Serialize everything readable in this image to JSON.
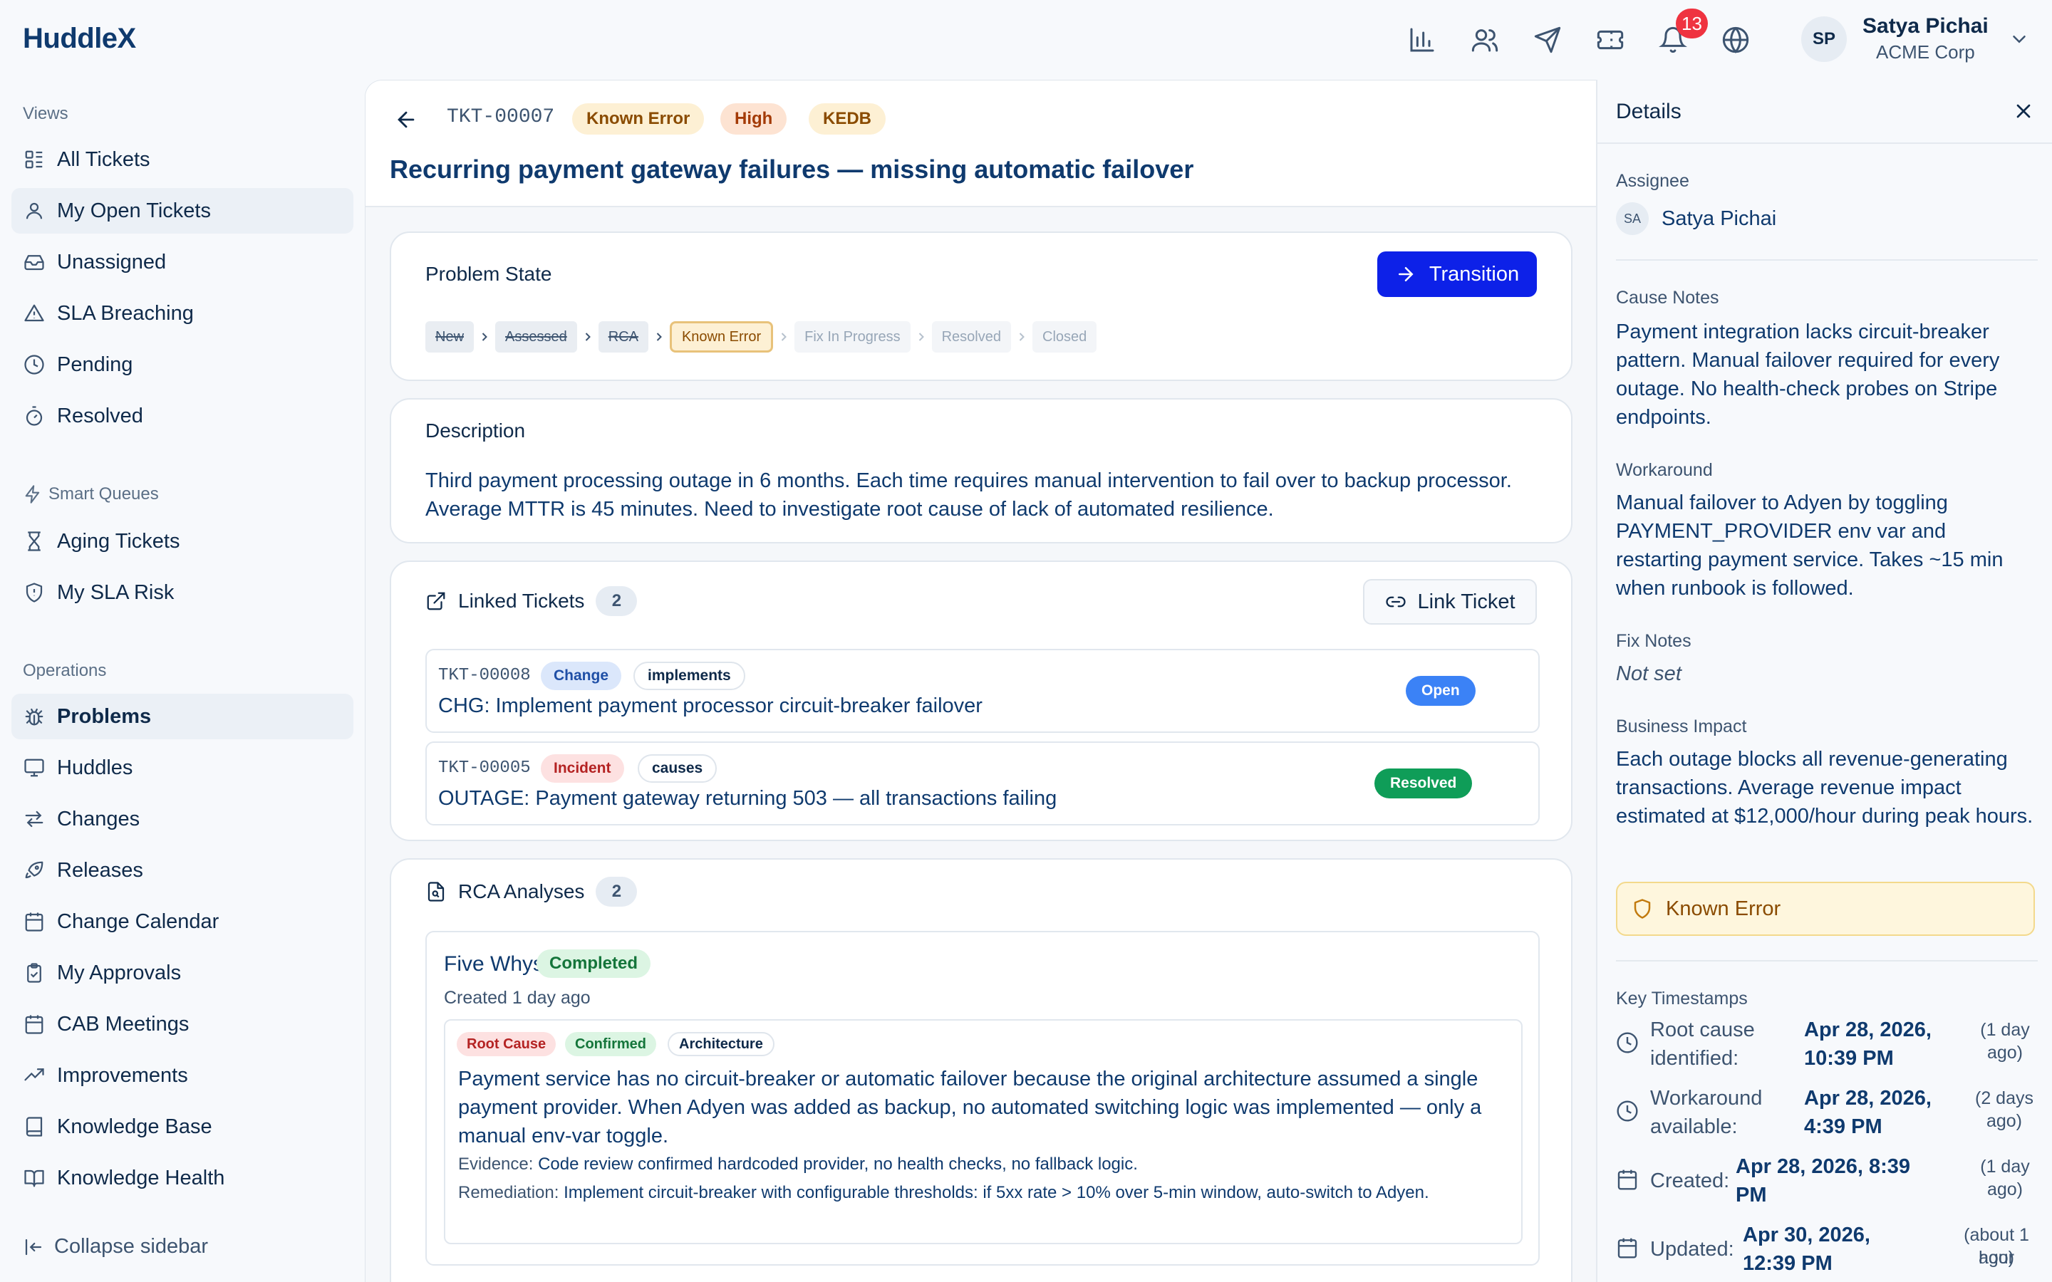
{
  "app": {
    "logo": "HuddleX"
  },
  "topbar": {
    "notification_count": "13",
    "user": {
      "initials": "SP",
      "name": "Satya Pichai",
      "org": "ACME Corp"
    }
  },
  "sidebar": {
    "views_label": "Views",
    "views": [
      {
        "label": "All Tickets",
        "icon": "list-icon"
      },
      {
        "label": "My Open Tickets",
        "icon": "user-icon"
      },
      {
        "label": "Unassigned",
        "icon": "inbox-icon"
      },
      {
        "label": "SLA Breaching",
        "icon": "warning-icon"
      },
      {
        "label": "Pending",
        "icon": "clock-icon"
      },
      {
        "label": "Resolved",
        "icon": "timer-icon"
      }
    ],
    "smart_label": "Smart Queues",
    "smart": [
      {
        "label": "Aging Tickets",
        "icon": "hourglass-icon"
      },
      {
        "label": "My SLA Risk",
        "icon": "shield-icon"
      }
    ],
    "ops_label": "Operations",
    "ops": [
      {
        "label": "Problems",
        "icon": "bug-icon"
      },
      {
        "label": "Huddles",
        "icon": "monitor-icon"
      },
      {
        "label": "Changes",
        "icon": "swap-icon"
      },
      {
        "label": "Releases",
        "icon": "rocket-icon"
      },
      {
        "label": "Change Calendar",
        "icon": "calendar-icon"
      },
      {
        "label": "My Approvals",
        "icon": "clipboard-icon"
      },
      {
        "label": "CAB Meetings",
        "icon": "calendar-grid-icon"
      },
      {
        "label": "Improvements",
        "icon": "trend-up-icon"
      },
      {
        "label": "Knowledge Base",
        "icon": "book-icon"
      },
      {
        "label": "Knowledge Health",
        "icon": "book-open-icon"
      }
    ],
    "collapse": "Collapse sidebar"
  },
  "ticket": {
    "id": "TKT-00007",
    "badges": [
      "Known Error",
      "High",
      "KEDB"
    ],
    "title": "Recurring payment gateway failures — missing automatic failover"
  },
  "problem_state": {
    "title": "Problem State",
    "transition_label": "Transition",
    "steps": [
      "New",
      "Assessed",
      "RCA",
      "Known Error",
      "Fix In Progress",
      "Resolved",
      "Closed"
    ],
    "current_step": "Known Error"
  },
  "description": {
    "title": "Description",
    "text": "Third payment processing outage in 6 months. Each time requires manual intervention to fail over to backup processor. Average MTTR is 45 minutes. Need to investigate root cause of lack of automated resilience."
  },
  "linked": {
    "title": "Linked Tickets",
    "count": "2",
    "link_label": "Link Ticket",
    "items": [
      {
        "id": "TKT-00008",
        "type": "Change",
        "relation": "implements",
        "title": "CHG: Implement payment processor circuit-breaker failover",
        "status": "Open"
      },
      {
        "id": "TKT-00005",
        "type": "Incident",
        "relation": "causes",
        "title": "OUTAGE: Payment gateway returning 503 — all transactions failing",
        "status": "Resolved"
      }
    ]
  },
  "rca": {
    "title": "RCA Analyses",
    "count": "2",
    "item": {
      "name": "Five Whys",
      "status": "Completed",
      "created": "Created 1 day ago",
      "tags": [
        "Root Cause",
        "Confirmed",
        "Architecture"
      ],
      "text": "Payment service has no circuit-breaker or automatic failover because the original architecture assumed a single payment provider. When Adyen was added as backup, no automated switching logic was implemented — only a manual env-var toggle.",
      "evidence_label": "Evidence:",
      "evidence": "Code review confirmed hardcoded provider, no health checks, no fallback logic.",
      "remediation_label": "Remediation:",
      "remediation": "Implement circuit-breaker with configurable thresholds: if 5xx rate > 10% over 5-min window, auto-switch to Adyen."
    }
  },
  "details": {
    "title": "Details",
    "assignee_label": "Assignee",
    "assignee_initials": "SA",
    "assignee": "Satya Pichai",
    "cause_label": "Cause Notes",
    "cause": "Payment integration lacks circuit-breaker pattern. Manual failover required for every outage. No health-check probes on Stripe endpoints.",
    "workaround_label": "Workaround",
    "workaround": "Manual failover to Adyen by toggling PAYMENT_PROVIDER env var and restarting payment service. Takes ~15 min when runbook is followed.",
    "fix_label": "Fix Notes",
    "fix": "Not set",
    "impact_label": "Business Impact",
    "impact": "Each outage blocks all revenue-generating transactions. Average revenue impact estimated at $12,000/hour during peak hours.",
    "known_error": "Known Error",
    "timestamps_label": "Key Timestamps",
    "timestamps": [
      {
        "label1": "Root cause",
        "label2": "identified:",
        "value1": "Apr 28, 2026,",
        "value2": "10:39 PM",
        "rel1": "(1 day",
        "rel2": "ago)"
      },
      {
        "label1": "Workaround",
        "label2": "available:",
        "value1": "Apr 28, 2026,",
        "value2": "4:39 PM",
        "rel1": "(2 days",
        "rel2": "ago)"
      },
      {
        "label1": "Created:",
        "value1": "Apr 28, 2026, 8:39",
        "value2": "PM",
        "rel1": "(1 day",
        "rel2": "ago)"
      },
      {
        "label1": "Updated:",
        "value1": "Apr 30, 2026,",
        "value2": "12:39 PM",
        "rel1": "(about 1 hour",
        "rel2": "ago)"
      }
    ]
  },
  "colors": {
    "primary": "#0d21e8",
    "brand": "#0f3a6e",
    "open": "#3b82f6",
    "resolved": "#0f9d58",
    "danger": "#ef3340",
    "warning_bg": "#fef6dd"
  }
}
